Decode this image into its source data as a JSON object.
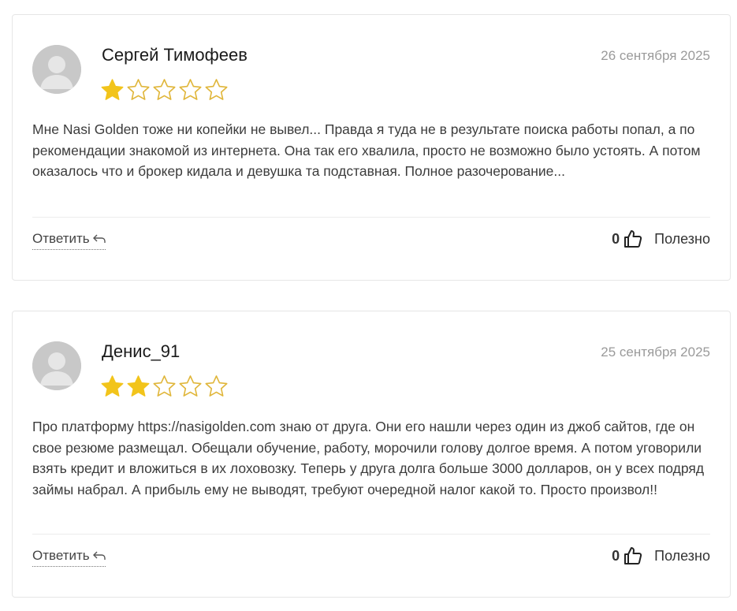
{
  "reviews": [
    {
      "author": "Сергей Тимофеев",
      "date": "26 сентября 2025",
      "rating": 1,
      "max_rating": 5,
      "text": "Мне Nasi Golden тоже ни копейки не вывел... Правда я туда не в результате поиска работы попал, а по рекомендации знакомой из интернета. Она так его хвалила, просто не возможно было устоять. А потом оказалось что и брокер кидала и девушка та подставная. Полное разочерование...",
      "reply_label": "Ответить",
      "helpful_count": "0",
      "helpful_label": "Полезно"
    },
    {
      "author": "Денис_91",
      "date": "25 сентября 2025",
      "rating": 2,
      "max_rating": 5,
      "text": "Про платформу https://nasigolden.com знаю от друга. Они его нашли через один из джоб сайтов, где он свое резюме размещал. Обещали обучение, работу, морочили голову долгое время. А потом уговорили взять кредит и вложиться в их лоховозку. Теперь у друга долга больше 3000 долларов, он у всех подряд займы набрал. А прибыль ему не выводят, требуют очередной налог какой то. Просто произвол!!",
      "reply_label": "Ответить",
      "helpful_count": "0",
      "helpful_label": "Полезно"
    }
  ],
  "colors": {
    "star_filled": "#f2c41b",
    "star_empty_stroke": "#e0b63a",
    "avatar_bg": "#c8c8c8",
    "date": "#9a9a9a"
  }
}
